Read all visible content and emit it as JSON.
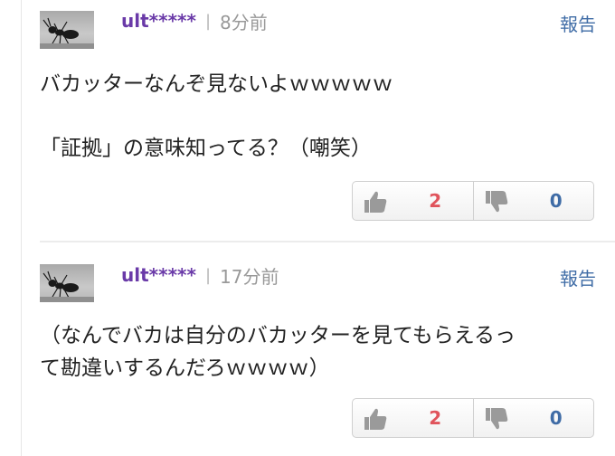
{
  "comments": [
    {
      "username": "ult*****",
      "separator": "|",
      "time": "8分前",
      "report_label": "報告",
      "body": "バカッターなんぞ見ないよｗｗｗｗｗ\n\n「証拠」の意味知ってる？（嘲笑）",
      "votes": {
        "good": "2",
        "bad": "0"
      },
      "avatar_icon": "ant-avatar-icon"
    },
    {
      "username": "ult*****",
      "separator": "|",
      "time": "17分前",
      "report_label": "報告",
      "body": "（なんでバカは自分のバカッターを見てもらえるっ\nて勘違いするんだろｗｗｗｗ）",
      "votes": {
        "good": "2",
        "bad": "0"
      },
      "avatar_icon": "ant-avatar-icon"
    }
  ],
  "icons": {
    "good": "thumbs-up-icon",
    "bad": "thumbs-down-icon"
  },
  "colors": {
    "username": "#6a3aa8",
    "report_link": "#3f6ca6",
    "good_count": "#e0545c",
    "bad_count": "#3f6ca6"
  }
}
